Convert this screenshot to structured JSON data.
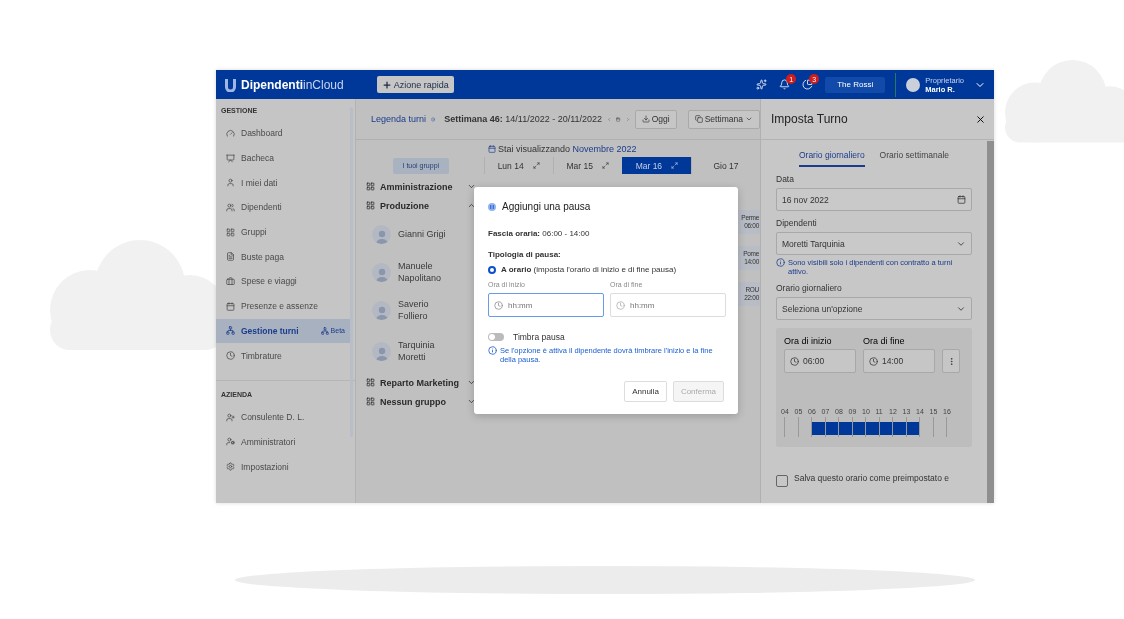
{
  "topbar": {
    "logo_bold": "Dipendenti",
    "logo_light": "inCloud",
    "quick_action": "Azione rapida",
    "notifications": [
      {
        "badge": "1"
      },
      {
        "badge": "3"
      }
    ],
    "company": "The Rossi",
    "user_role": "Proprietario",
    "user_name": "Mario R."
  },
  "sidebar": {
    "sections": [
      {
        "title": "GESTIONE",
        "items": [
          {
            "label": "Dashboard",
            "selected": false
          },
          {
            "label": "Bacheca",
            "selected": false
          },
          {
            "label": "I miei dati",
            "selected": false
          },
          {
            "label": "Dipendenti",
            "selected": false
          },
          {
            "label": "Gruppi",
            "selected": false
          },
          {
            "label": "Buste paga",
            "selected": false
          },
          {
            "label": "Spese e viaggi",
            "selected": false
          },
          {
            "label": "Presenze e assenze",
            "selected": false
          },
          {
            "label": "Gestione turni",
            "selected": true,
            "badge": "Beta"
          },
          {
            "label": "Timbrature",
            "selected": false
          }
        ]
      },
      {
        "title": "AZIENDA",
        "items": [
          {
            "label": "Consulente D. L.",
            "selected": false
          },
          {
            "label": "Amministratori",
            "selected": false
          },
          {
            "label": "Impostazioni",
            "selected": false
          }
        ]
      }
    ]
  },
  "toolbar": {
    "legend": "Legenda turni",
    "week_label": "Settimana 46:",
    "week_range": "14/11/2022 - 20/11/2022",
    "today": "Oggi",
    "view": "Settimana"
  },
  "viewing": {
    "prefix": "Stai visualizzando",
    "month": "Novembre 2022"
  },
  "groups_button": "I tuoi gruppi",
  "days": [
    {
      "label": "Lun 14",
      "selected": false
    },
    {
      "label": "Mar 15",
      "selected": false
    },
    {
      "label": "Mar 16",
      "selected": true
    },
    {
      "label": "Gio 17",
      "selected": false
    }
  ],
  "rows": [
    {
      "kind": "group",
      "name": "Amministrazione",
      "expanded": false
    },
    {
      "kind": "group",
      "name": "Produzione",
      "expanded": true
    },
    {
      "kind": "employee",
      "name": "Gianni Grigi"
    },
    {
      "kind": "employee",
      "name": "Manuele Napolitano"
    },
    {
      "kind": "employee",
      "name": "Saverio Folliero"
    },
    {
      "kind": "employee",
      "name": "Tarquinia Moretti"
    },
    {
      "kind": "group",
      "name": "Reparto Marketing",
      "expanded": false
    },
    {
      "kind": "group",
      "name": "Nessun gruppo",
      "expanded": false
    }
  ],
  "shift_fragments": [
    {
      "name": "Perme",
      "time": "06:00"
    },
    {
      "name": "Pome",
      "time": "14:00"
    },
    {
      "name": "ROU",
      "time": "22:00"
    }
  ],
  "modal": {
    "title": "Aggiungi una pausa",
    "range_label": "Fascia oraria:",
    "range_value": "06:00 - 14:00",
    "type_label": "Tipologia di pausa:",
    "option": {
      "label": "A orario",
      "hint": "(imposta l'orario di inizio e di fine pausa)",
      "selected": true
    },
    "start": {
      "label": "Ora di inizio",
      "placeholder": "hh:mm"
    },
    "end": {
      "label": "Ora di fine",
      "placeholder": "hh:mm"
    },
    "toggle": {
      "label": "Timbra pausa",
      "on": false
    },
    "info": "Se l'opzione è attiva il dipendente dovrà timbrare l'inizio e la fine della pausa.",
    "cancel": "Annulla",
    "confirm": {
      "label": "Conferma",
      "disabled": true
    }
  },
  "panel": {
    "title": "Imposta Turno",
    "tabs": [
      {
        "label": "Orario giornaliero",
        "selected": true
      },
      {
        "label": "Orario settimanale",
        "selected": false
      }
    ],
    "date_label": "Data",
    "date_value": "16 nov 2022",
    "employees_label": "Dipendenti",
    "employees_value": "Moretti Tarquinia",
    "employees_info": "Sono visibili solo i dipendenti con contratto a turni attivo.",
    "schedule_label": "Orario giornaliero",
    "schedule_placeholder": "Seleziona un'opzione",
    "start_label": "Ora di inizio",
    "start_value": "06:00",
    "end_label": "Ora di fine",
    "end_value": "14:00",
    "hours": [
      {
        "label": "04",
        "in_shift": false
      },
      {
        "label": "05",
        "in_shift": false
      },
      {
        "label": "06",
        "in_shift": true
      },
      {
        "label": "07",
        "in_shift": true
      },
      {
        "label": "08",
        "in_shift": true
      },
      {
        "label": "09",
        "in_shift": true
      },
      {
        "label": "10",
        "in_shift": true
      },
      {
        "label": "11",
        "in_shift": true
      },
      {
        "label": "12",
        "in_shift": true
      },
      {
        "label": "13",
        "in_shift": true
      },
      {
        "label": "14",
        "in_shift": false
      },
      {
        "label": "15",
        "in_shift": false
      },
      {
        "label": "16",
        "in_shift": false
      }
    ],
    "save": {
      "label": "Salva questo orario come preimpostato e",
      "checked": false
    }
  }
}
